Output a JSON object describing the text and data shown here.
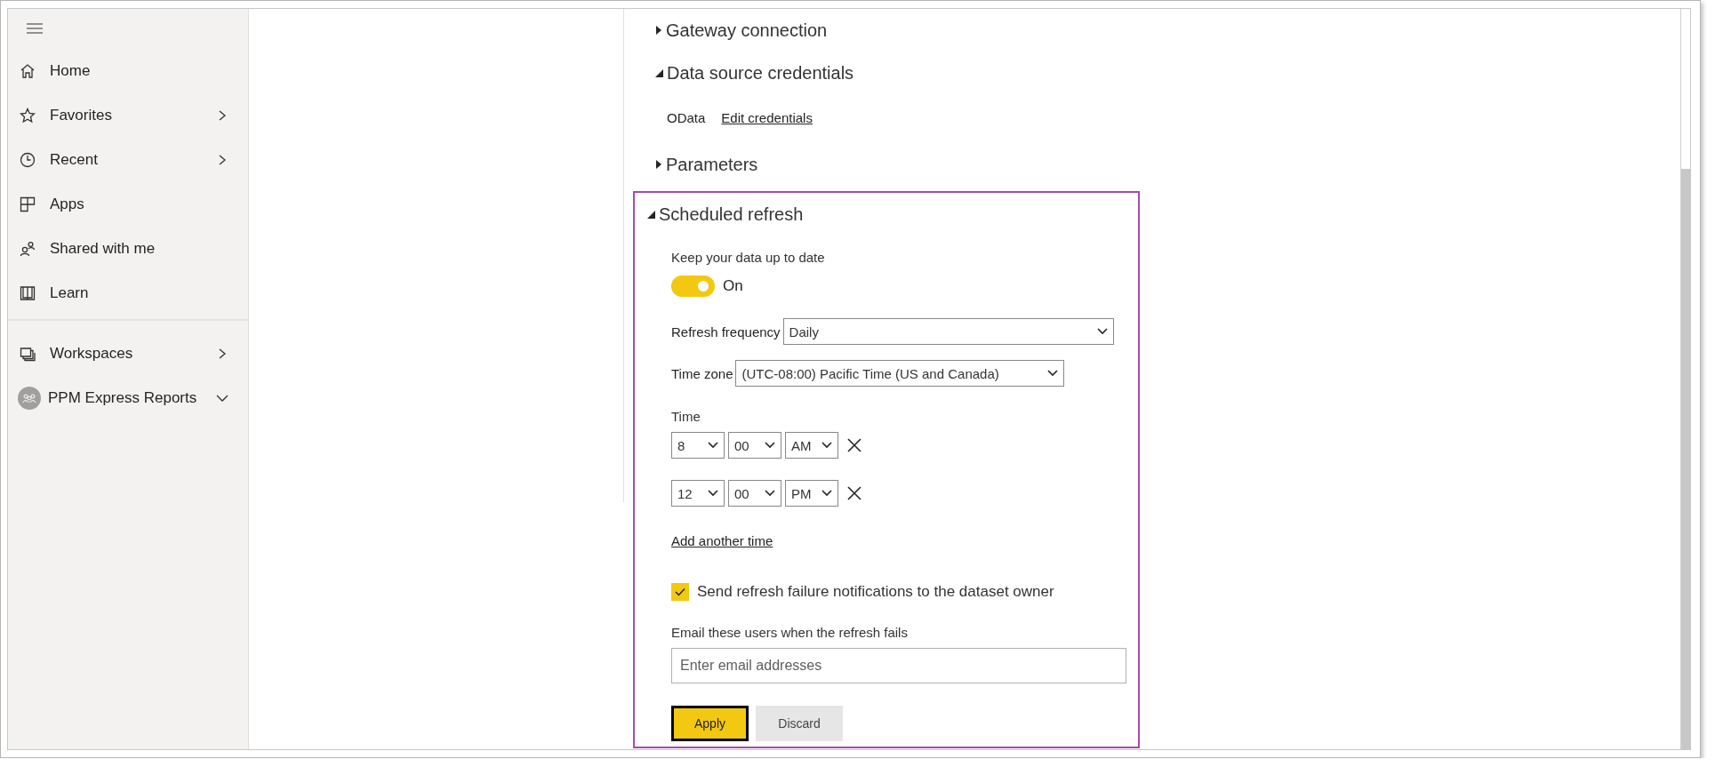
{
  "sidebar": {
    "items": [
      {
        "label": "Home"
      },
      {
        "label": "Favorites",
        "expanded": false
      },
      {
        "label": "Recent",
        "expanded": false
      },
      {
        "label": "Apps"
      },
      {
        "label": "Shared with me"
      },
      {
        "label": "Learn"
      }
    ],
    "workspace_items": [
      {
        "label": "Workspaces",
        "expanded": false,
        "kind": "list"
      },
      {
        "label": "PPM Express Reports",
        "expanded": true,
        "kind": "workspace"
      }
    ]
  },
  "sections": [
    {
      "title": "Gateway connection",
      "expanded": false,
      "highlighted": false
    },
    {
      "title": "Data source credentials",
      "expanded": true,
      "highlighted": false,
      "credentials": [
        {
          "source": "OData",
          "link": "Edit credentials"
        }
      ]
    },
    {
      "title": "Parameters",
      "expanded": false,
      "highlighted": false
    },
    {
      "title": "Scheduled refresh",
      "expanded": true,
      "highlighted": true,
      "schedule": {
        "keep_label": "Keep your data up to date",
        "toggle": {
          "on": true,
          "label": "On"
        },
        "frequency": {
          "label": "Refresh frequency",
          "value": "Daily"
        },
        "time_zone": {
          "label": "Time zone",
          "value": "(UTC-08:00) Pacific Time (US and Canada)"
        },
        "time_label": "Time",
        "times": [
          {
            "hour": "8",
            "minute": "00",
            "period": "AM"
          },
          {
            "hour": "12",
            "minute": "00",
            "period": "PM"
          }
        ],
        "add_time_link": "Add another time",
        "notify": {
          "label": "Send refresh failure notifications to the dataset owner",
          "checked": true
        },
        "email_label": "Email these users when the refresh fails",
        "email_field": {
          "placeholder": "Enter email addresses"
        },
        "buttons": [
          {
            "label": "Apply",
            "primary": true
          },
          {
            "label": "Discard",
            "primary": false
          }
        ]
      }
    }
  ]
}
